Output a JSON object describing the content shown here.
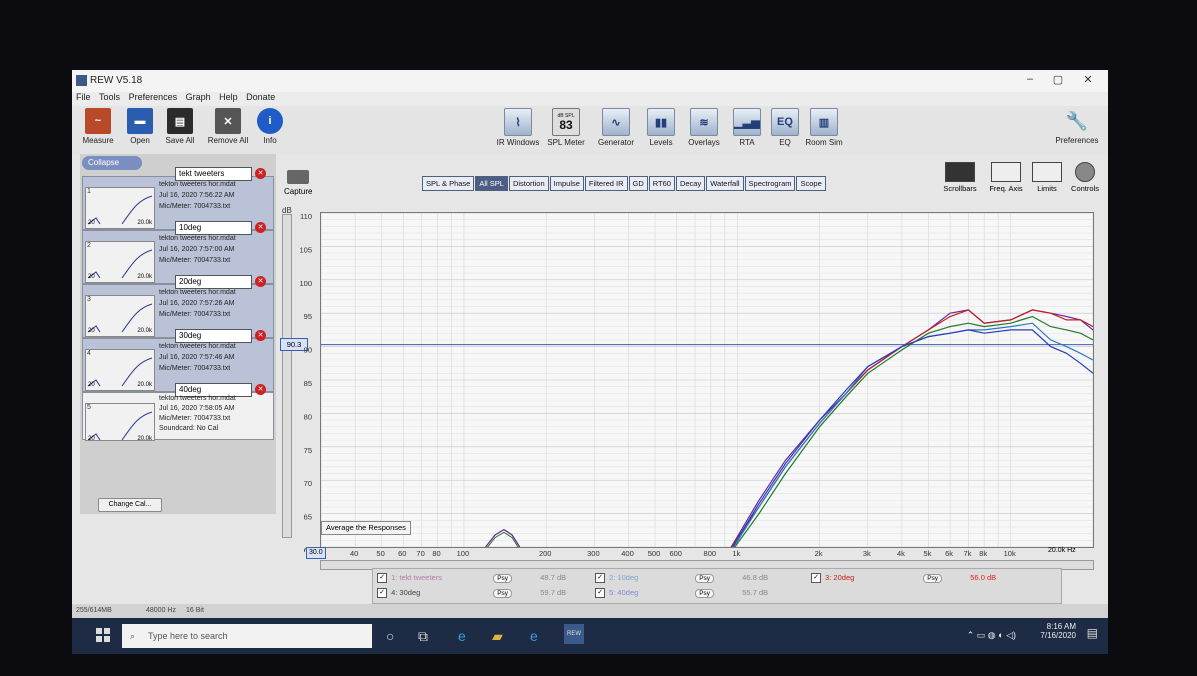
{
  "window": {
    "title": "REW V5.18",
    "controls": [
      "–",
      "▢",
      "✕"
    ]
  },
  "menu": [
    "File",
    "Tools",
    "Preferences",
    "Graph",
    "Help",
    "Donate"
  ],
  "toolbar_left": [
    {
      "label": "Measure",
      "icon": "measure-icon"
    },
    {
      "label": "Open",
      "icon": "folder-open-icon"
    },
    {
      "label": "Save All",
      "icon": "save-icon"
    },
    {
      "label": "Remove All",
      "icon": "remove-all-icon"
    },
    {
      "label": "Info",
      "icon": "info-icon"
    }
  ],
  "toolbar_center": [
    {
      "label": "IR Windows",
      "icon": "ir-windows-icon"
    },
    {
      "label": "SPL Meter",
      "icon": "spl-meter-icon",
      "badge": "83",
      "badge_caption": "dB SPL"
    },
    {
      "label": "Generator",
      "icon": "generator-icon"
    },
    {
      "label": "Levels",
      "icon": "levels-icon"
    },
    {
      "label": "Overlays",
      "icon": "overlays-icon"
    },
    {
      "label": "RTA",
      "icon": "rta-icon"
    },
    {
      "label": "EQ",
      "icon": "eq-icon"
    },
    {
      "label": "Room Sim",
      "icon": "room-sim-icon"
    }
  ],
  "preferences_label": "Preferences",
  "collapse_label": "Collapse",
  "measurements": [
    {
      "num": "1",
      "name": "tekt tweeters",
      "file": "tekton tweeters hor.mdat",
      "date": "Jul 16, 2020 7:56:22 AM",
      "mic": "Mic/Meter: 7004733.txt"
    },
    {
      "num": "2",
      "name": "10deg",
      "file": "tekton tweeters hor.mdat",
      "date": "Jul 16, 2020 7:57:00 AM",
      "mic": "Mic/Meter: 7004733.txt"
    },
    {
      "num": "3",
      "name": "20deg",
      "file": "tekton tweeters hor.mdat",
      "date": "Jul 16, 2020 7:57:26 AM",
      "mic": "Mic/Meter: 7004733.txt"
    },
    {
      "num": "4",
      "name": "30deg",
      "file": "tekton tweeters hor.mdat",
      "date": "Jul 16, 2020 7:57:46 AM",
      "mic": "Mic/Meter: 7004733.txt"
    },
    {
      "num": "5",
      "name": "40deg",
      "file": "tekton tweeters hor.mdat",
      "date": "Jul 16, 2020 7:58:05 AM",
      "mic": "Mic/Meter: 7004733.txt",
      "soundcard": "Soundcard: No Cal"
    }
  ],
  "thumb_labels": {
    "lo": "20",
    "hi": "20.0k"
  },
  "change_cal_label": "Change Cal...",
  "capture_label": "Capture",
  "tabs": [
    "SPL & Phase",
    "All SPL",
    "Distortion",
    "Impulse",
    "Filtered IR",
    "GD",
    "RT60",
    "Decay",
    "Waterfall",
    "Spectrogram",
    "Scope"
  ],
  "active_tab": "All SPL",
  "right_tools": [
    "Scrollbars",
    "Freq. Axis",
    "Limits",
    "Controls"
  ],
  "avg_button_label": "Average the Responses",
  "cursor_readout": "90.3",
  "x_readout_start": "30.0",
  "x_readout_end": "20.0k Hz",
  "legend": [
    {
      "check": "✓",
      "label": "1: tekt tweeters",
      "psy": "Psy",
      "level": "48.7 dB",
      "color": "#6a2aa0"
    },
    {
      "check": "✓",
      "label": "2: 10deg",
      "psy": "Psy",
      "level": "46.8 dB",
      "color": "#2a7abf"
    },
    {
      "check": "✓",
      "label": "3: 20deg",
      "psy": "Psy",
      "level": "56.0 dB",
      "color": "#c21f1f"
    },
    {
      "check": "✓",
      "label": "4: 30deg",
      "psy": "Psy",
      "level": "59.7 dB",
      "color": "#1f7a2a"
    },
    {
      "check": "✓",
      "label": "5: 40deg",
      "psy": "Psy",
      "level": "55.7 dB",
      "color": "#2a3abf"
    }
  ],
  "status": {
    "left": "255/614MB",
    "rate": "48000 Hz",
    "bits": "16 Bit"
  },
  "taskbar": {
    "search_placeholder": "Type here to search",
    "time": "8:16 AM",
    "date": "7/16/2020"
  },
  "chart_data": {
    "type": "line",
    "ylabel": "dB",
    "xlabel": "",
    "xscale": "log",
    "xlim": [
      30,
      20000
    ],
    "ylim": [
      60,
      110
    ],
    "y_ticks": [
      60,
      65,
      70,
      75,
      80,
      85,
      90,
      95,
      100,
      105,
      110
    ],
    "x_ticks": [
      {
        "v": 40,
        "l": "40"
      },
      {
        "v": 50,
        "l": "50"
      },
      {
        "v": 60,
        "l": "60"
      },
      {
        "v": 70,
        "l": "70"
      },
      {
        "v": 80,
        "l": "80"
      },
      {
        "v": 100,
        "l": "100"
      },
      {
        "v": 200,
        "l": "200"
      },
      {
        "v": 300,
        "l": "300"
      },
      {
        "v": 400,
        "l": "400"
      },
      {
        "v": 500,
        "l": "500"
      },
      {
        "v": 600,
        "l": "600"
      },
      {
        "v": 800,
        "l": "800"
      },
      {
        "v": 1000,
        "l": "1k"
      },
      {
        "v": 2000,
        "l": "2k"
      },
      {
        "v": 3000,
        "l": "3k"
      },
      {
        "v": 4000,
        "l": "4k"
      },
      {
        "v": 5000,
        "l": "5k"
      },
      {
        "v": 6000,
        "l": "6k"
      },
      {
        "v": 7000,
        "l": "7k"
      },
      {
        "v": 8000,
        "l": "8k"
      },
      {
        "v": 10000,
        "l": "10k"
      }
    ],
    "cursor_y": 90.3,
    "bump": {
      "x": [
        120,
        130,
        140,
        150,
        160
      ],
      "y": [
        60,
        61.8,
        62.6,
        61.8,
        60
      ]
    },
    "series": [
      {
        "color": "#6a2aa0",
        "x": [
          950,
          1200,
          1500,
          2000,
          2500,
          3000,
          4000,
          5000,
          6000,
          7000,
          8000,
          10000,
          12000,
          14000,
          16000,
          18000,
          20000
        ],
        "y": [
          60,
          67,
          73,
          79,
          83,
          86.5,
          90,
          92.5,
          95,
          95.5,
          93.5,
          94,
          95.5,
          95,
          94.5,
          94,
          92.5
        ]
      },
      {
        "color": "#c21f1f",
        "x": [
          950,
          1200,
          1500,
          2000,
          2500,
          3000,
          4000,
          5000,
          6000,
          7000,
          8000,
          10000,
          12000,
          14000,
          16000,
          18000,
          20000
        ],
        "y": [
          60,
          66,
          72,
          78.5,
          83,
          86.5,
          90,
          92.5,
          94.5,
          95.5,
          93.5,
          94,
          95.5,
          95,
          94,
          94,
          93
        ]
      },
      {
        "color": "#1f7a2a",
        "x": [
          980,
          1200,
          1500,
          2000,
          2500,
          3000,
          4000,
          5000,
          6000,
          7000,
          8000,
          10000,
          12000,
          14000,
          16000,
          18000,
          20000
        ],
        "y": [
          60,
          65,
          71,
          78,
          82.5,
          86,
          89.5,
          92,
          93,
          93.5,
          93,
          93.5,
          94.5,
          93,
          92.5,
          92,
          91
        ]
      },
      {
        "color": "#2a7abf",
        "x": [
          970,
          1200,
          1500,
          2000,
          2500,
          3000,
          4000,
          5000,
          6000,
          7000,
          8000,
          10000,
          12000,
          14000,
          16000,
          18000,
          20000
        ],
        "y": [
          60,
          66,
          72,
          78.5,
          83,
          87,
          90,
          91.5,
          92,
          92.5,
          92.5,
          93,
          93.5,
          91,
          90,
          89,
          88
        ]
      },
      {
        "color": "#2a3abf",
        "x": [
          960,
          1200,
          1500,
          2000,
          2500,
          3000,
          4000,
          5000,
          6000,
          7000,
          8000,
          10000,
          12000,
          14000,
          16000,
          18000,
          20000
        ],
        "y": [
          60,
          66.5,
          72.5,
          79,
          83.5,
          87,
          90,
          91.5,
          92,
          92.5,
          92,
          92.5,
          92.5,
          90,
          89,
          87.5,
          86
        ]
      }
    ]
  }
}
